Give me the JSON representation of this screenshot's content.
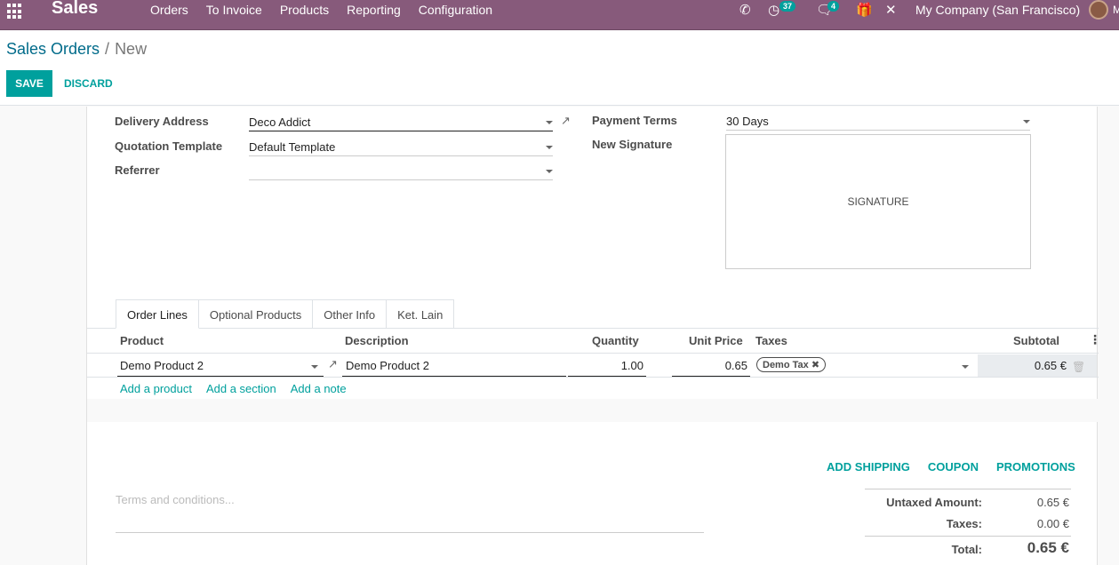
{
  "navbar": {
    "app_name": "Sales",
    "menu": [
      "Orders",
      "To Invoice",
      "Products",
      "Reporting",
      "Configuration"
    ],
    "activity_count": "37",
    "message_count": "4",
    "company": "My Company (San Francisco)",
    "user_initial": "M",
    "bg_color": "#875a7b"
  },
  "control_panel": {
    "breadcrumb_parent": "Sales Orders",
    "breadcrumb_sep": "/",
    "breadcrumb_current": "New",
    "save_label": "SAVE",
    "discard_label": "DISCARD"
  },
  "form": {
    "delivery_address_label": "Delivery Address",
    "delivery_address_value": "Deco Addict",
    "quotation_template_label": "Quotation Template",
    "quotation_template_value": "Default Template",
    "referrer_label": "Referrer",
    "referrer_value": "",
    "payment_terms_label": "Payment Terms",
    "payment_terms_value": "30 Days",
    "new_signature_label": "New Signature",
    "signature_placeholder": "SIGNATURE"
  },
  "tabs": [
    "Order Lines",
    "Optional Products",
    "Other Info",
    "Ket. Lain"
  ],
  "order_lines": {
    "columns": {
      "product": "Product",
      "description": "Description",
      "quantity": "Quantity",
      "unit_price": "Unit Price",
      "taxes": "Taxes",
      "subtotal": "Subtotal"
    },
    "rows": [
      {
        "product": "Demo Product 2",
        "description": "Demo Product 2",
        "quantity": "1.00",
        "unit_price": "0.65",
        "tax_tag": "Demo Tax",
        "subtotal": "0.65 €"
      }
    ],
    "add_product": "Add a product",
    "add_section": "Add a section",
    "add_note": "Add a note"
  },
  "actions": {
    "add_shipping": "ADD SHIPPING",
    "coupon": "COUPON",
    "promotions": "PROMOTIONS"
  },
  "terms_placeholder": "Terms and conditions...",
  "totals": {
    "untaxed_label": "Untaxed Amount:",
    "untaxed_value": "0.65 €",
    "taxes_label": "Taxes:",
    "taxes_value": "0.00 €",
    "total_label": "Total:",
    "total_value": "0.65 €"
  },
  "accent_color": "#00a09d"
}
